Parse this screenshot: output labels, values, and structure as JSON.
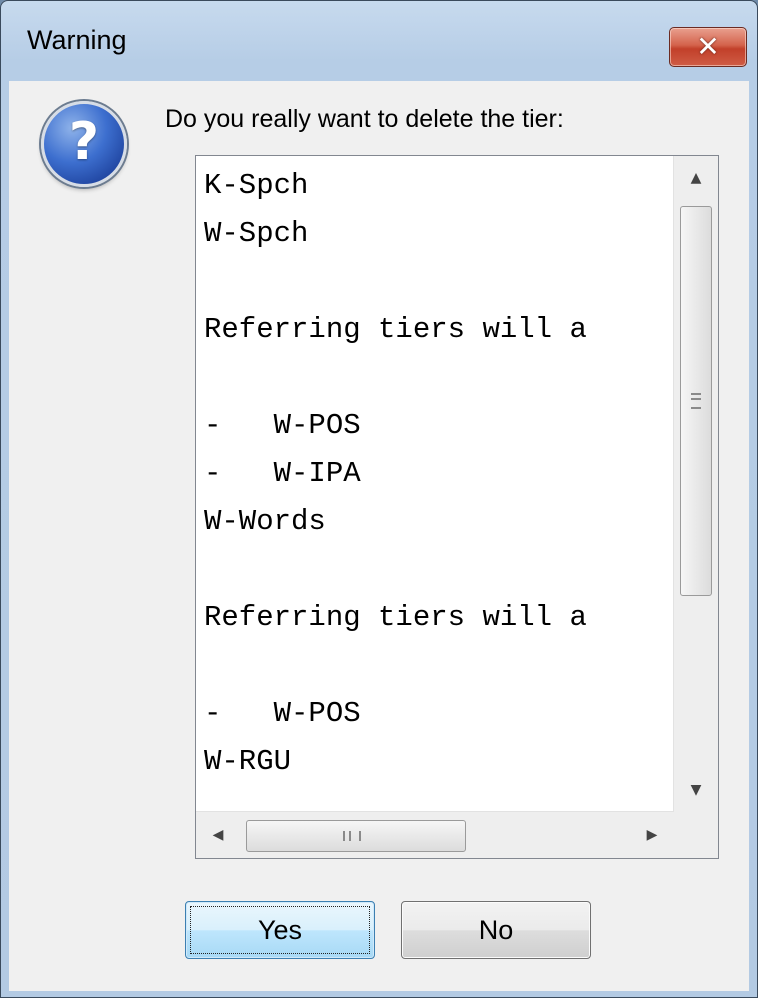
{
  "window": {
    "title": "Warning",
    "close_glyph": "✕"
  },
  "dialog": {
    "icon": "question-icon",
    "icon_glyph": "?",
    "prompt": "Do you really want to delete the tier:",
    "list_lines": [
      "K-Spch",
      "W-Spch",
      "",
      "Referring tiers will a",
      "",
      "-   W-POS",
      "-   W-IPA",
      "W-Words",
      "",
      "Referring tiers will a",
      "",
      "-   W-POS",
      "W-RGU"
    ],
    "scrollbar": {
      "up_glyph": "▲",
      "down_glyph": "▼",
      "left_glyph": "◀",
      "right_glyph": "▶"
    }
  },
  "buttons": {
    "yes_label": "Yes",
    "no_label": "No"
  }
}
